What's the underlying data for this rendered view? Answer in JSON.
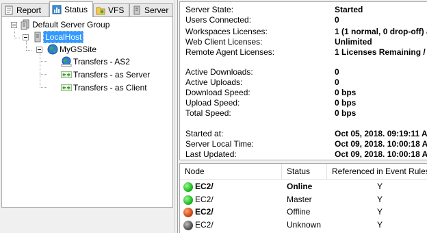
{
  "tabs": [
    {
      "label": "Report",
      "icon": "report-icon",
      "active": false
    },
    {
      "label": "Status",
      "icon": "status-icon",
      "active": true
    },
    {
      "label": "VFS",
      "icon": "vfs-folder-icon",
      "active": false
    },
    {
      "label": "Server",
      "icon": "server-icon",
      "active": false
    }
  ],
  "tree": {
    "root": {
      "label": "Default Server Group",
      "icon": "server-group-icon"
    },
    "host": {
      "label": "LocalHost",
      "icon": "server-icon",
      "selected": true
    },
    "site": {
      "label": "MyGSSite",
      "icon": "globe-icon"
    },
    "items": [
      {
        "label": "Transfers - AS2",
        "icon": "as2-globe-icon"
      },
      {
        "label": "Transfers - as Server",
        "icon": "transfer-arrows-icon"
      },
      {
        "label": "Transfers - as Client",
        "icon": "transfer-arrows-icon"
      }
    ]
  },
  "status": {
    "group1": [
      {
        "key": "Server State:",
        "value": "Started"
      },
      {
        "key": "Users Connected:",
        "value": "0"
      },
      {
        "key": "Workspaces Licenses:",
        "value": "1 (1 normal, 0 drop-off) a"
      },
      {
        "key": "Web Client Licenses:",
        "value": "Unlimited"
      },
      {
        "key": "Remote Agent Licenses:",
        "value": "1 Licenses Remaining / '"
      }
    ],
    "group2": [
      {
        "key": "Active Downloads:",
        "value": "0"
      },
      {
        "key": "Active Uploads:",
        "value": "0"
      },
      {
        "key": "Download Speed:",
        "value": "0 bps"
      },
      {
        "key": "Upload Speed:",
        "value": "0 bps"
      },
      {
        "key": "Total Speed:",
        "value": "0 bps"
      }
    ],
    "group3": [
      {
        "key": "Started at:",
        "value": "Oct 05, 2018. 09:19:11 A"
      },
      {
        "key": "Server Local Time:",
        "value": "Oct 09, 2018. 10:00:18 A"
      },
      {
        "key": "Last Updated:",
        "value": "Oct 09, 2018. 10:00:18 A"
      }
    ]
  },
  "nodes": {
    "headers": [
      "Node",
      "Status",
      "Referenced in Event Rules"
    ],
    "rows": [
      {
        "node": "EC2/",
        "status": "Online",
        "referenced": "Y",
        "color": "#1fbf1f"
      },
      {
        "node": "EC2/",
        "status": "Master",
        "referenced": "Y",
        "color": "#1fbf1f"
      },
      {
        "node": "EC2/",
        "status": "Offline",
        "referenced": "Y",
        "color": "#d24a12"
      },
      {
        "node": "EC2/",
        "status": "Unknown",
        "referenced": "Y",
        "color": "#555555"
      }
    ]
  }
}
